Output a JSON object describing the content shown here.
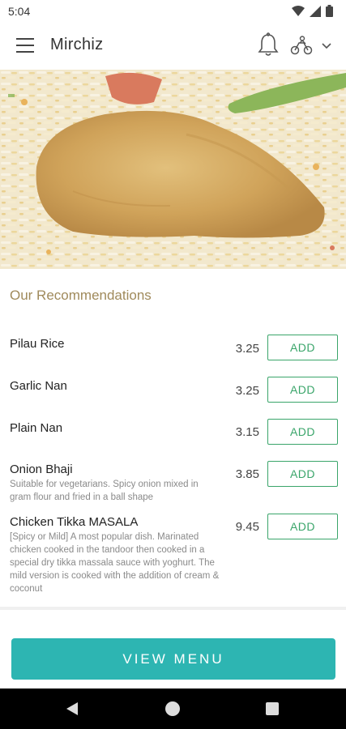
{
  "status_bar": {
    "time": "5:04"
  },
  "app_bar": {
    "title": "Mirchiz"
  },
  "section": {
    "title": "Our Recommendations"
  },
  "items": [
    {
      "name": "Pilau Rice",
      "description": "",
      "price": "3.25",
      "action": "ADD"
    },
    {
      "name": "Garlic Nan",
      "description": "",
      "price": "3.25",
      "action": "ADD"
    },
    {
      "name": "Plain Nan",
      "description": "",
      "price": "3.15",
      "action": "ADD"
    },
    {
      "name": "Onion Bhaji",
      "description": "Suitable for vegetarians. Spicy onion mixed in gram flour and fried in a ball shape",
      "price": "3.85",
      "action": "ADD"
    },
    {
      "name": "Chicken Tikka MASALA",
      "description": "[Spicy or Mild] A most popular dish. Marinated chicken cooked in the tandoor then cooked in a special dry tikka massala sauce with yoghurt. The mild version is cooked with the addition of cream & coconut",
      "price": "9.45",
      "action": "ADD"
    }
  ],
  "footer": {
    "view_menu_label": "VIEW MENU"
  },
  "colors": {
    "accent": "#2db5b2",
    "add_green": "#3aa56a",
    "section_title": "#a08a5b"
  }
}
